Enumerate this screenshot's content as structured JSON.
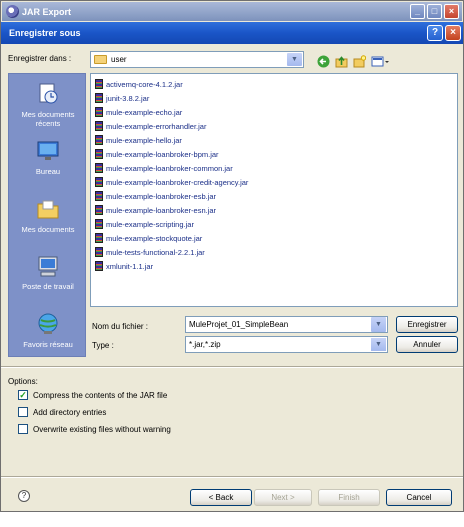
{
  "outer_window": {
    "title": "JAR Export",
    "minimize": "_",
    "maximize": "□",
    "close": "×"
  },
  "save_dialog": {
    "title": "Enregistrer sous",
    "help_btn": "?",
    "close_btn": "×",
    "look_in_label": "Enregistrer dans :",
    "look_in_value": "user"
  },
  "places": [
    {
      "label": "Mes documents récents",
      "icon": "recent-documents-icon"
    },
    {
      "label": "Bureau",
      "icon": "desktop-icon"
    },
    {
      "label": "Mes documents",
      "icon": "my-documents-icon"
    },
    {
      "label": "Poste de travail",
      "icon": "my-computer-icon"
    },
    {
      "label": "Favoris réseau",
      "icon": "network-places-icon"
    }
  ],
  "files": [
    "activemq-core-4.1.2.jar",
    "junit-3.8.2.jar",
    "mule-example-echo.jar",
    "mule-example-errorhandler.jar",
    "mule-example-hello.jar",
    "mule-example-loanbroker-bpm.jar",
    "mule-example-loanbroker-common.jar",
    "mule-example-loanbroker-credit-agency.jar",
    "mule-example-loanbroker-esb.jar",
    "mule-example-loanbroker-esn.jar",
    "mule-example-scripting.jar",
    "mule-example-stockquote.jar",
    "mule-tests-functional-2.2.1.jar",
    "xmlunit-1.1.jar"
  ],
  "filename_label": "Nom du fichier :",
  "filename_value": "MuleProjet_01_SimpleBean",
  "type_label": "Type :",
  "type_value": "*.jar,*.zip",
  "save_button": "Enregistrer",
  "cancel_button_fr": "Annuler",
  "options": {
    "label": "Options:",
    "items": [
      {
        "label": "Compress the contents of the JAR file",
        "checked": true
      },
      {
        "label": "Add directory entries",
        "checked": false
      },
      {
        "label": "Overwrite existing files without warning",
        "checked": false
      }
    ]
  },
  "wizard": {
    "help": "?",
    "back": "< Back",
    "next": "Next >",
    "finish": "Finish",
    "cancel": "Cancel"
  }
}
